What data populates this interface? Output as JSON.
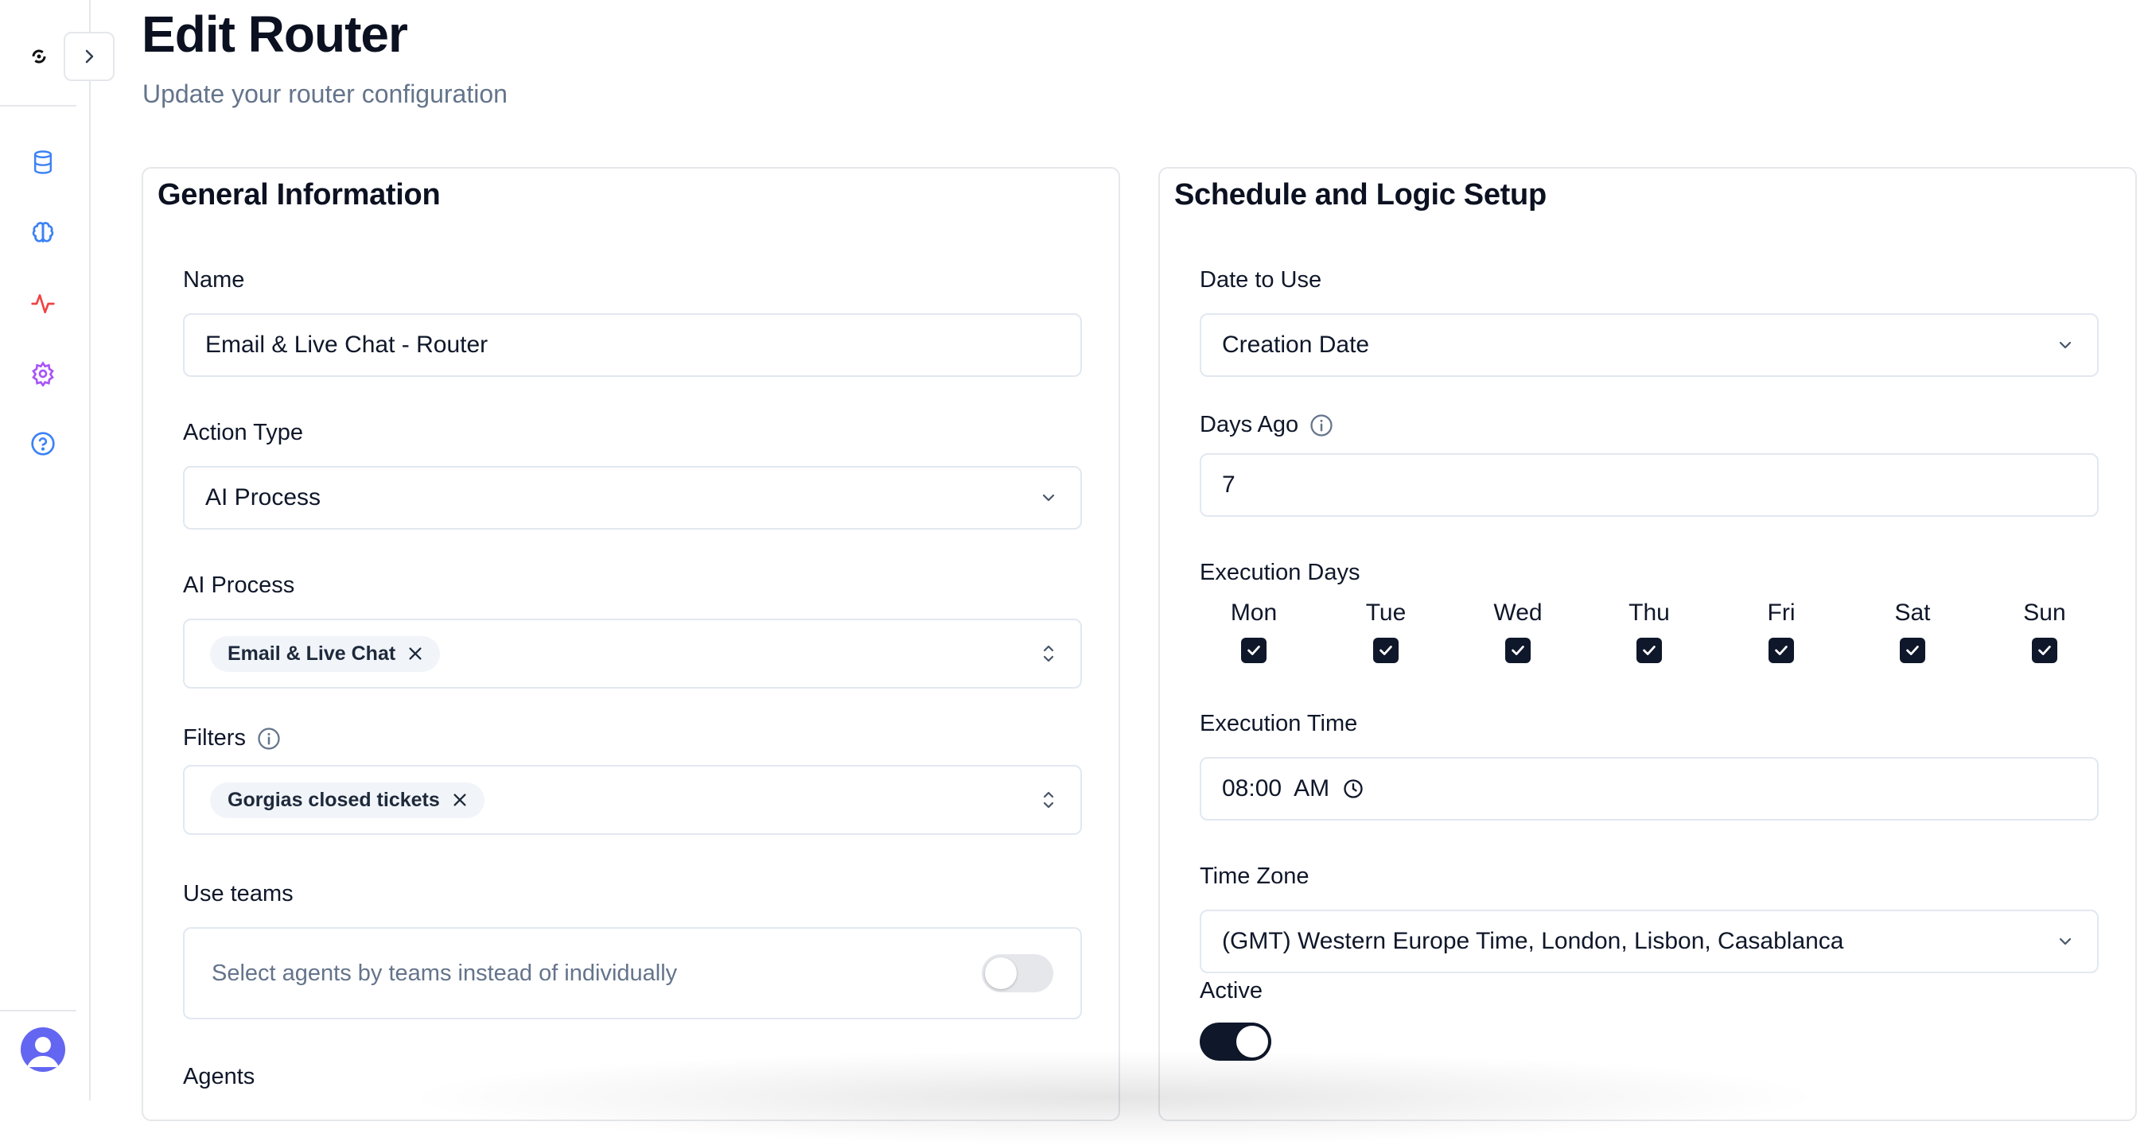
{
  "header": {
    "title": "Edit Router",
    "subtitle": "Update your router configuration"
  },
  "sidebar": {
    "items": [
      {
        "icon": "database-icon",
        "color": "#3b82f6"
      },
      {
        "icon": "brain-icon",
        "color": "#3b82f6"
      },
      {
        "icon": "activity-icon",
        "color": "#ef4444"
      },
      {
        "icon": "gear-icon",
        "color": "#a855f7"
      },
      {
        "icon": "help-circle-icon",
        "color": "#3b82f6"
      }
    ]
  },
  "general": {
    "title": "General Information",
    "name_label": "Name",
    "name_value": "Email & Live Chat - Router",
    "action_type_label": "Action Type",
    "action_type_value": "AI Process",
    "ai_process_label": "AI Process",
    "ai_process_tag": "Email & Live Chat",
    "filters_label": "Filters",
    "filters_tag": "Gorgias closed tickets",
    "use_teams_label": "Use teams",
    "use_teams_text": "Select agents by teams instead of individually",
    "use_teams_on": false,
    "agents_label": "Agents"
  },
  "schedule": {
    "title": "Schedule and Logic Setup",
    "date_label": "Date to Use",
    "date_value": "Creation Date",
    "days_ago_label": "Days Ago",
    "days_ago_value": "7",
    "exec_days_label": "Execution Days",
    "days": [
      {
        "name": "Mon",
        "checked": true
      },
      {
        "name": "Tue",
        "checked": true
      },
      {
        "name": "Wed",
        "checked": true
      },
      {
        "name": "Thu",
        "checked": true
      },
      {
        "name": "Fri",
        "checked": true
      },
      {
        "name": "Sat",
        "checked": true
      },
      {
        "name": "Sun",
        "checked": true
      }
    ],
    "exec_time_label": "Execution Time",
    "exec_time_value": "08:00  AM",
    "timezone_label": "Time Zone",
    "timezone_value": "(GMT) Western Europe Time, London, Lisbon, Casablanca",
    "active_label": "Active",
    "active_on": true
  },
  "colors": {
    "primary_dark": "#0f172a",
    "border": "#e2e8f0",
    "muted_text": "#64748b"
  }
}
